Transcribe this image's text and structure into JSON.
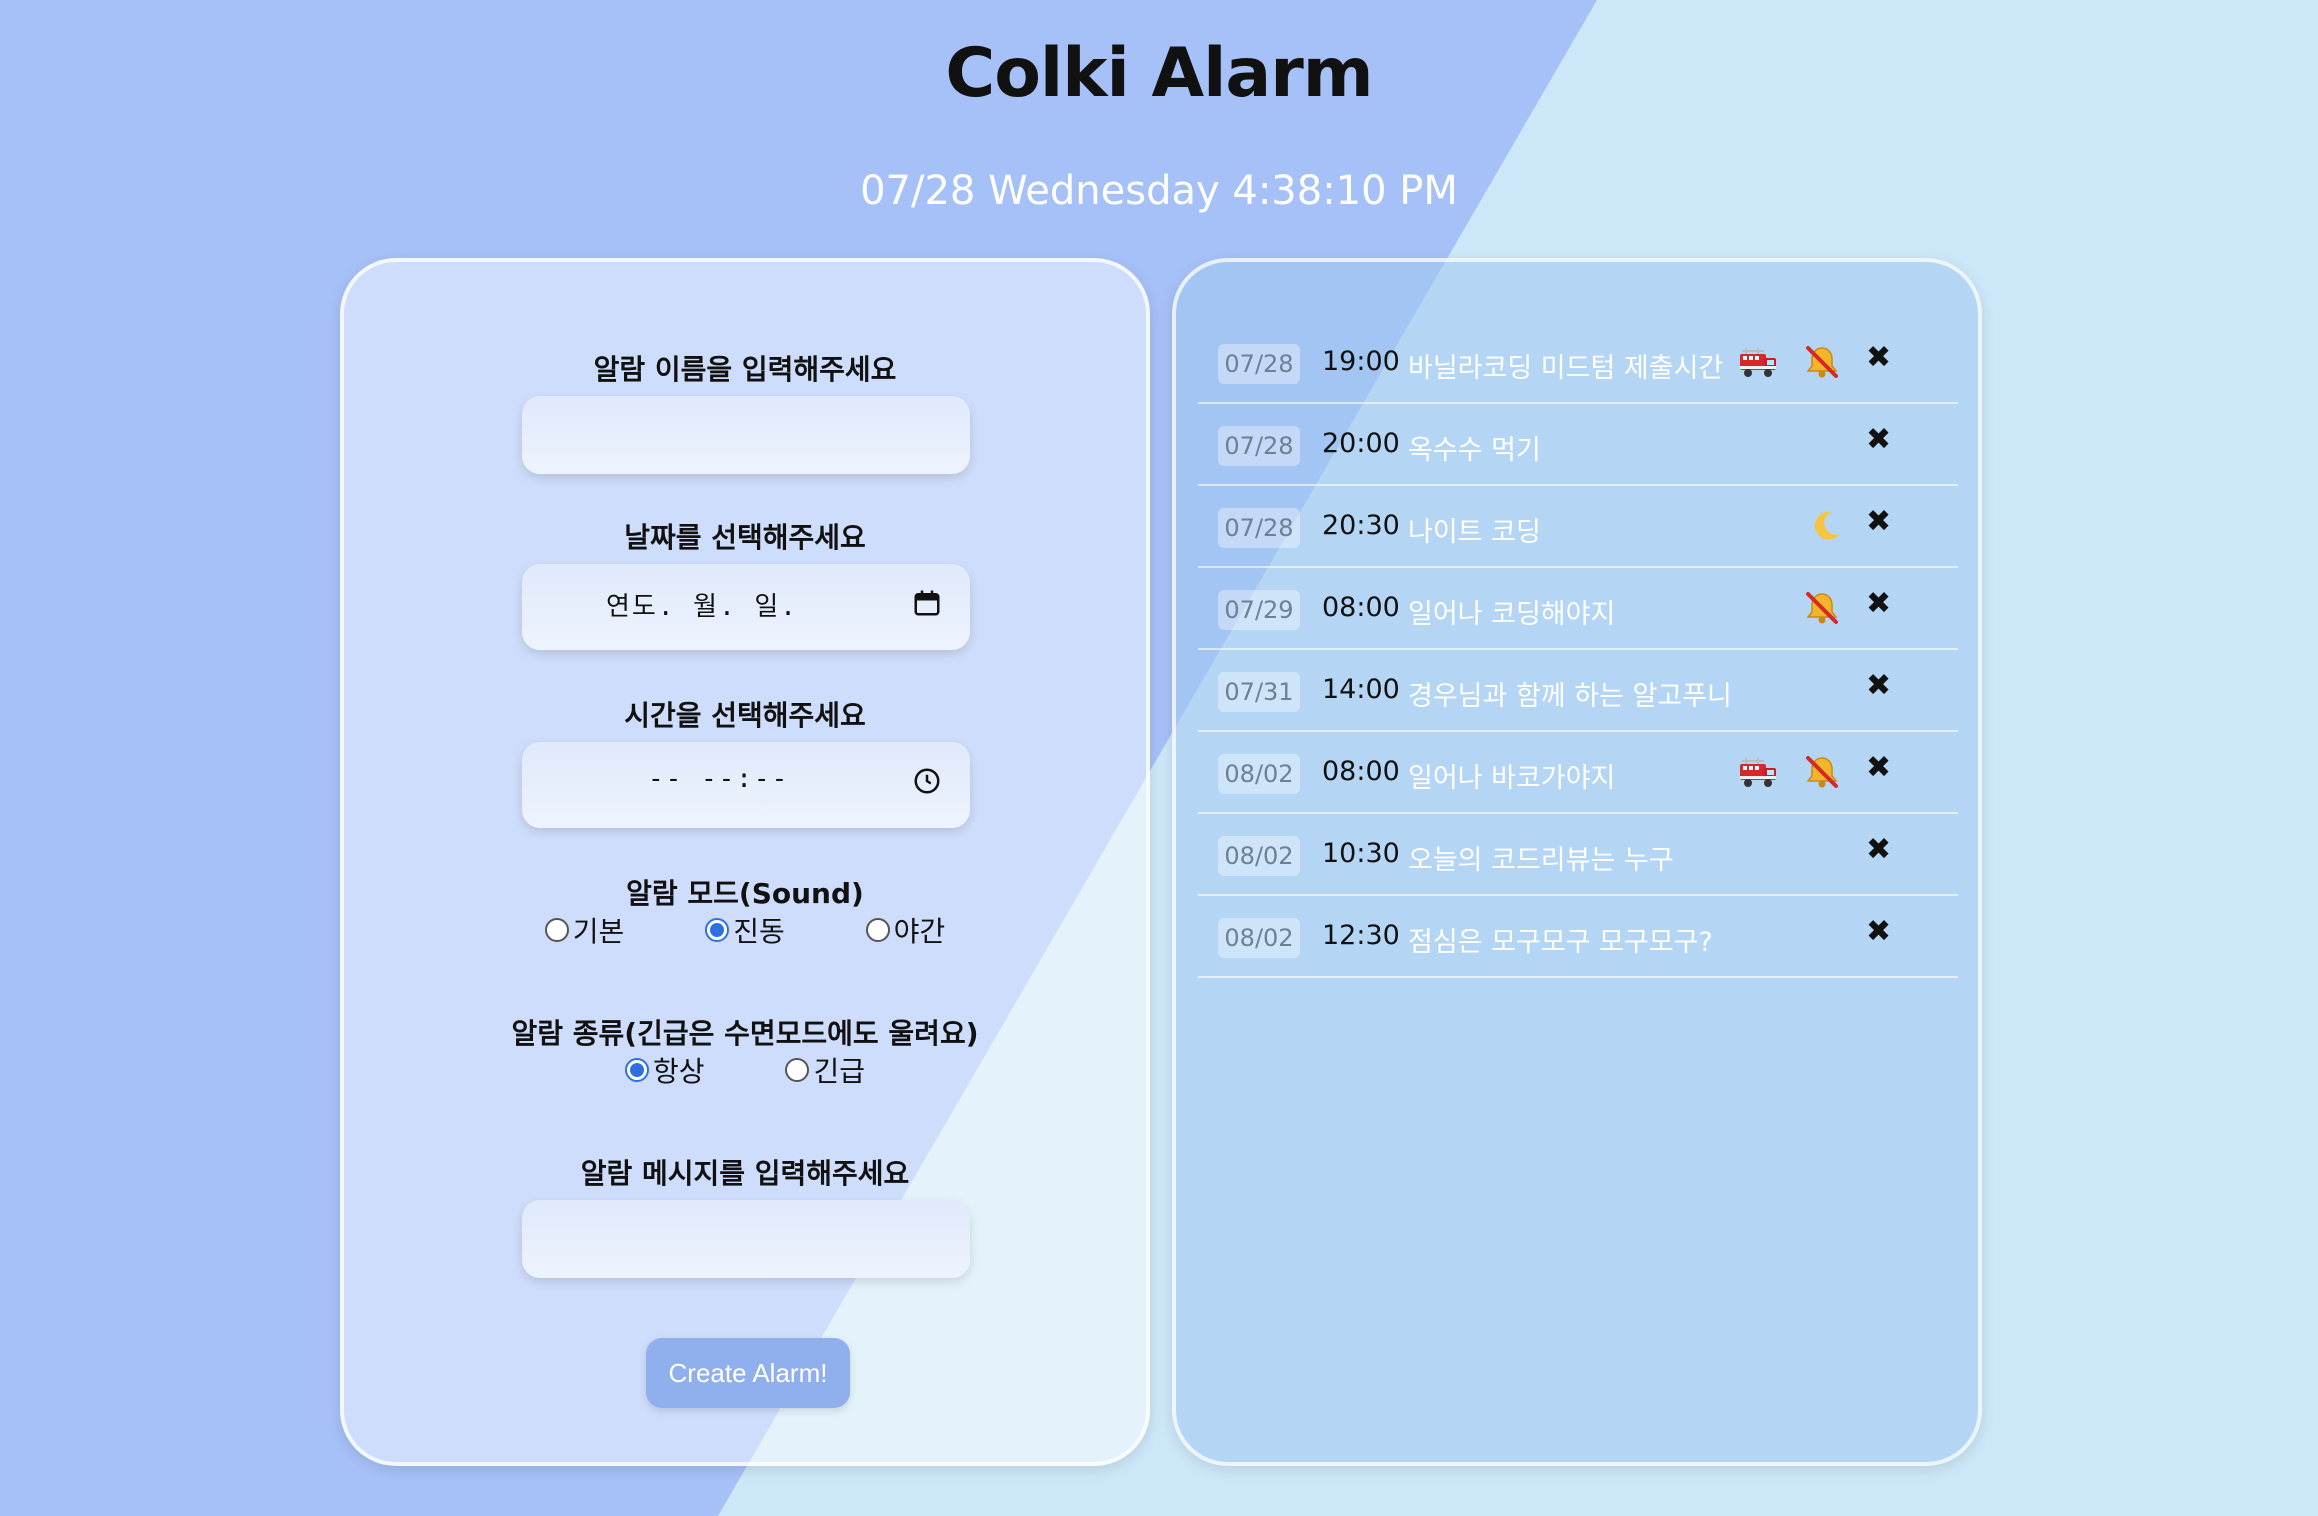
{
  "app": {
    "title": "Colki Alarm",
    "clock": "07/28 Wednesday 4:38:10 PM"
  },
  "form": {
    "name_label": "알람 이름을 입력해주세요",
    "name_value": "",
    "date_label": "날짜를 선택해주세요",
    "date_placeholder": "연도. 월. 일.",
    "time_label": "시간을 선택해주세요",
    "time_placeholder": "-- --:--",
    "mode_label": "알람 모드(Sound)",
    "mode_options": [
      {
        "label": "기본",
        "checked": false
      },
      {
        "label": "진동",
        "checked": true
      },
      {
        "label": "야간",
        "checked": false
      }
    ],
    "kind_label": "알람 종류(긴급은 수면모드에도 울려요)",
    "kind_options": [
      {
        "label": "항상",
        "checked": true
      },
      {
        "label": "긴급",
        "checked": false
      }
    ],
    "message_label": "알람 메시지를 입력해주세요",
    "message_value": "",
    "create_label": "Create Alarm!"
  },
  "alarms": [
    {
      "date": "07/28",
      "time": "19:00",
      "name": "바닐라코딩 미드텀 제출시간",
      "icons": [
        "fire-truck-icon",
        "bell-muted-icon"
      ]
    },
    {
      "date": "07/28",
      "time": "20:00",
      "name": "옥수수 먹기",
      "icons": []
    },
    {
      "date": "07/28",
      "time": "20:30",
      "name": "나이트 코딩",
      "icons": [
        "crescent-moon-icon"
      ]
    },
    {
      "date": "07/29",
      "time": "08:00",
      "name": "일어나 코딩해야지",
      "icons": [
        "bell-muted-icon"
      ]
    },
    {
      "date": "07/31",
      "time": "14:00",
      "name": "경우님과 함께 하는 알고푸니",
      "icons": []
    },
    {
      "date": "08/02",
      "time": "08:00",
      "name": "일어나 바코가야지",
      "icons": [
        "fire-truck-icon",
        "bell-muted-icon"
      ]
    },
    {
      "date": "08/02",
      "time": "10:30",
      "name": "오늘의 코드리뷰는 누구",
      "icons": []
    },
    {
      "date": "08/02",
      "time": "12:30",
      "name": "점심은 모구모구 모구모구?",
      "icons": []
    }
  ],
  "delete_glyph": "✖",
  "colors": {
    "background_left": "#a6c1f7",
    "background_right": "#cce7f8",
    "button": "#8fb0ec",
    "radio_accent": "#2f6fe6"
  }
}
